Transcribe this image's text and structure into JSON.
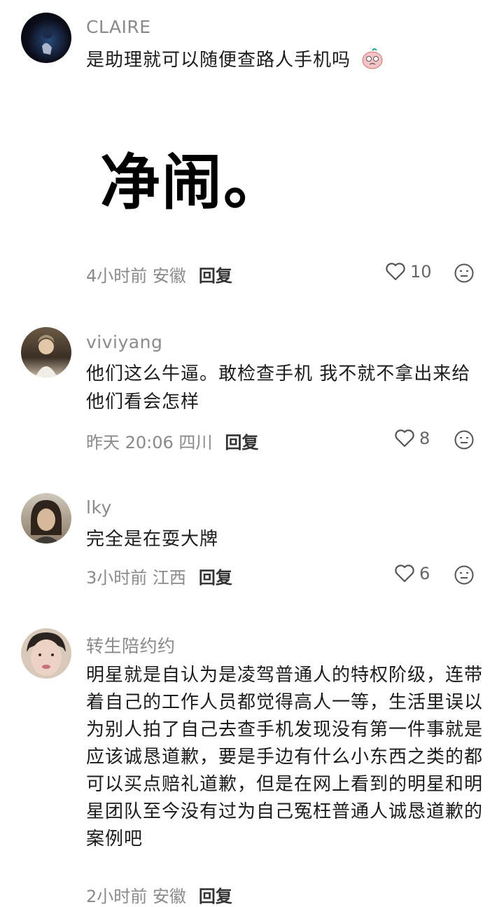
{
  "comments": [
    {
      "username": "CLAIRE",
      "text": "是助理就可以随便查路人手机吗",
      "sticker_text": "净闹。",
      "time_location": "4小时前 安徽",
      "reply": "回复",
      "likes": "10"
    },
    {
      "username": "viviyang",
      "text": "他们这么牛逼。敢检查手机 我不就不拿出来给他们看会怎样",
      "time_location": "昨天 20:06 四川",
      "reply": "回复",
      "likes": "8"
    },
    {
      "username": "lky",
      "text": "完全是在耍大牌",
      "time_location": "3小时前 江西",
      "reply": "回复",
      "likes": "6"
    },
    {
      "username": "转生陪约约",
      "text": "明星就是自认为是凌驾普通人的特权阶级，连带着自己的工作人员都觉得高人一等，生活里误以为别人拍了自己去查手机发现没有第一件事就是应该诚恳道歉，要是手边有什么小东西之类的都可以买点赔礼道歉，但是在网上看到的明星和明星团队至今没有过为自己冤枉普通人诚恳道歉的案例吧",
      "time_location": "2小时前 安徽",
      "reply": "回复"
    }
  ]
}
